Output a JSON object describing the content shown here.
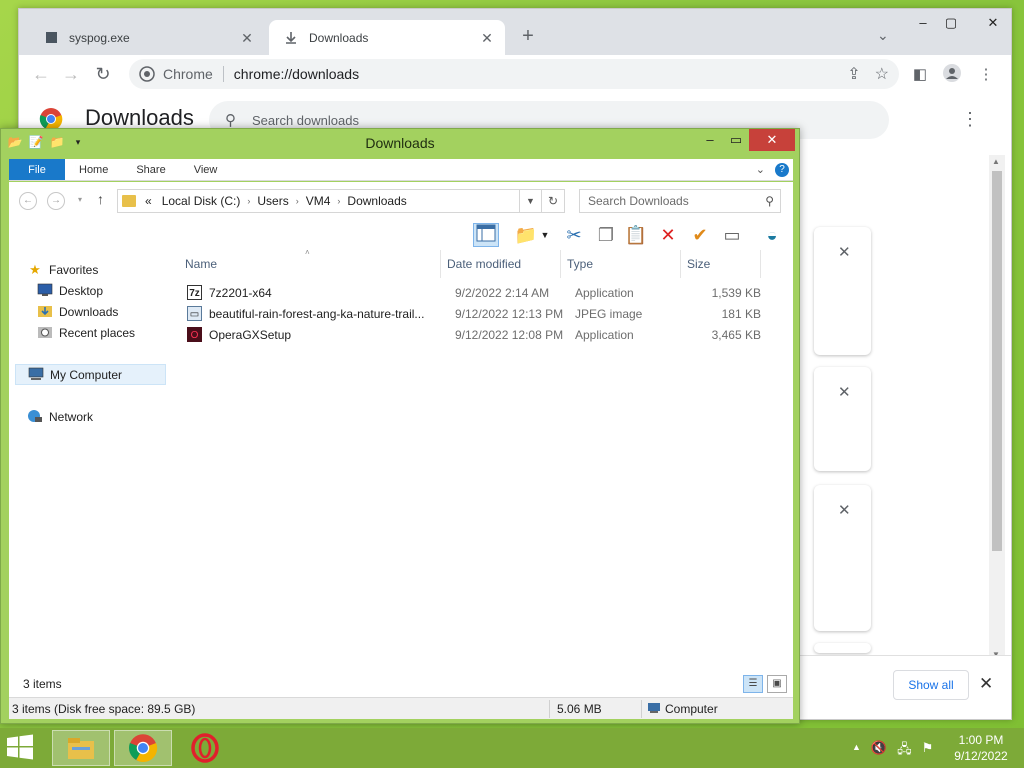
{
  "chrome": {
    "tabs": [
      {
        "title": "syspog.exe",
        "active": false
      },
      {
        "title": "Downloads",
        "active": true
      }
    ],
    "omnibox": {
      "chip": "Chrome",
      "url": "chrome://downloads"
    },
    "page": {
      "title": "Downloads",
      "search_placeholder": "Search downloads",
      "show_all": "Show all"
    }
  },
  "explorer": {
    "title": "Downloads",
    "ribbon_tabs": [
      "File",
      "Home",
      "Share",
      "View"
    ],
    "address": {
      "prefix": "«",
      "crumbs": [
        "Local Disk (C:)",
        "Users",
        "VM4",
        "Downloads"
      ]
    },
    "search_placeholder": "Search Downloads",
    "nav": {
      "favorites": "Favorites",
      "desktop": "Desktop",
      "downloads": "Downloads",
      "recent": "Recent places",
      "computer": "My Computer",
      "network": "Network"
    },
    "columns": {
      "name": "Name",
      "date": "Date modified",
      "type": "Type",
      "size": "Size"
    },
    "files": [
      {
        "name": "7z2201-x64",
        "date": "9/2/2022 2:14 AM",
        "type": "Application",
        "size": "1,539 KB",
        "icon": "7z-icon"
      },
      {
        "name": "beautiful-rain-forest-ang-ka-nature-trail...",
        "date": "9/12/2022 12:13 PM",
        "type": "JPEG image",
        "size": "181 KB",
        "icon": "image-icon"
      },
      {
        "name": "OperaGXSetup",
        "date": "9/12/2022 12:08 PM",
        "type": "Application",
        "size": "3,465 KB",
        "icon": "opera-icon"
      }
    ],
    "item_count": "3 items",
    "status": {
      "free_space": "3 items (Disk free space: 89.5 GB)",
      "size": "5.06 MB",
      "location": "Computer"
    }
  },
  "taskbar": {
    "time": "1:00 PM",
    "date": "9/12/2022"
  },
  "colors": {
    "desktop": "#8cc63f",
    "explorer_frame": "#a3d15f",
    "ribbon_file": "#1979ca",
    "close_red": "#c7413a",
    "link_blue": "#1a73e8"
  }
}
